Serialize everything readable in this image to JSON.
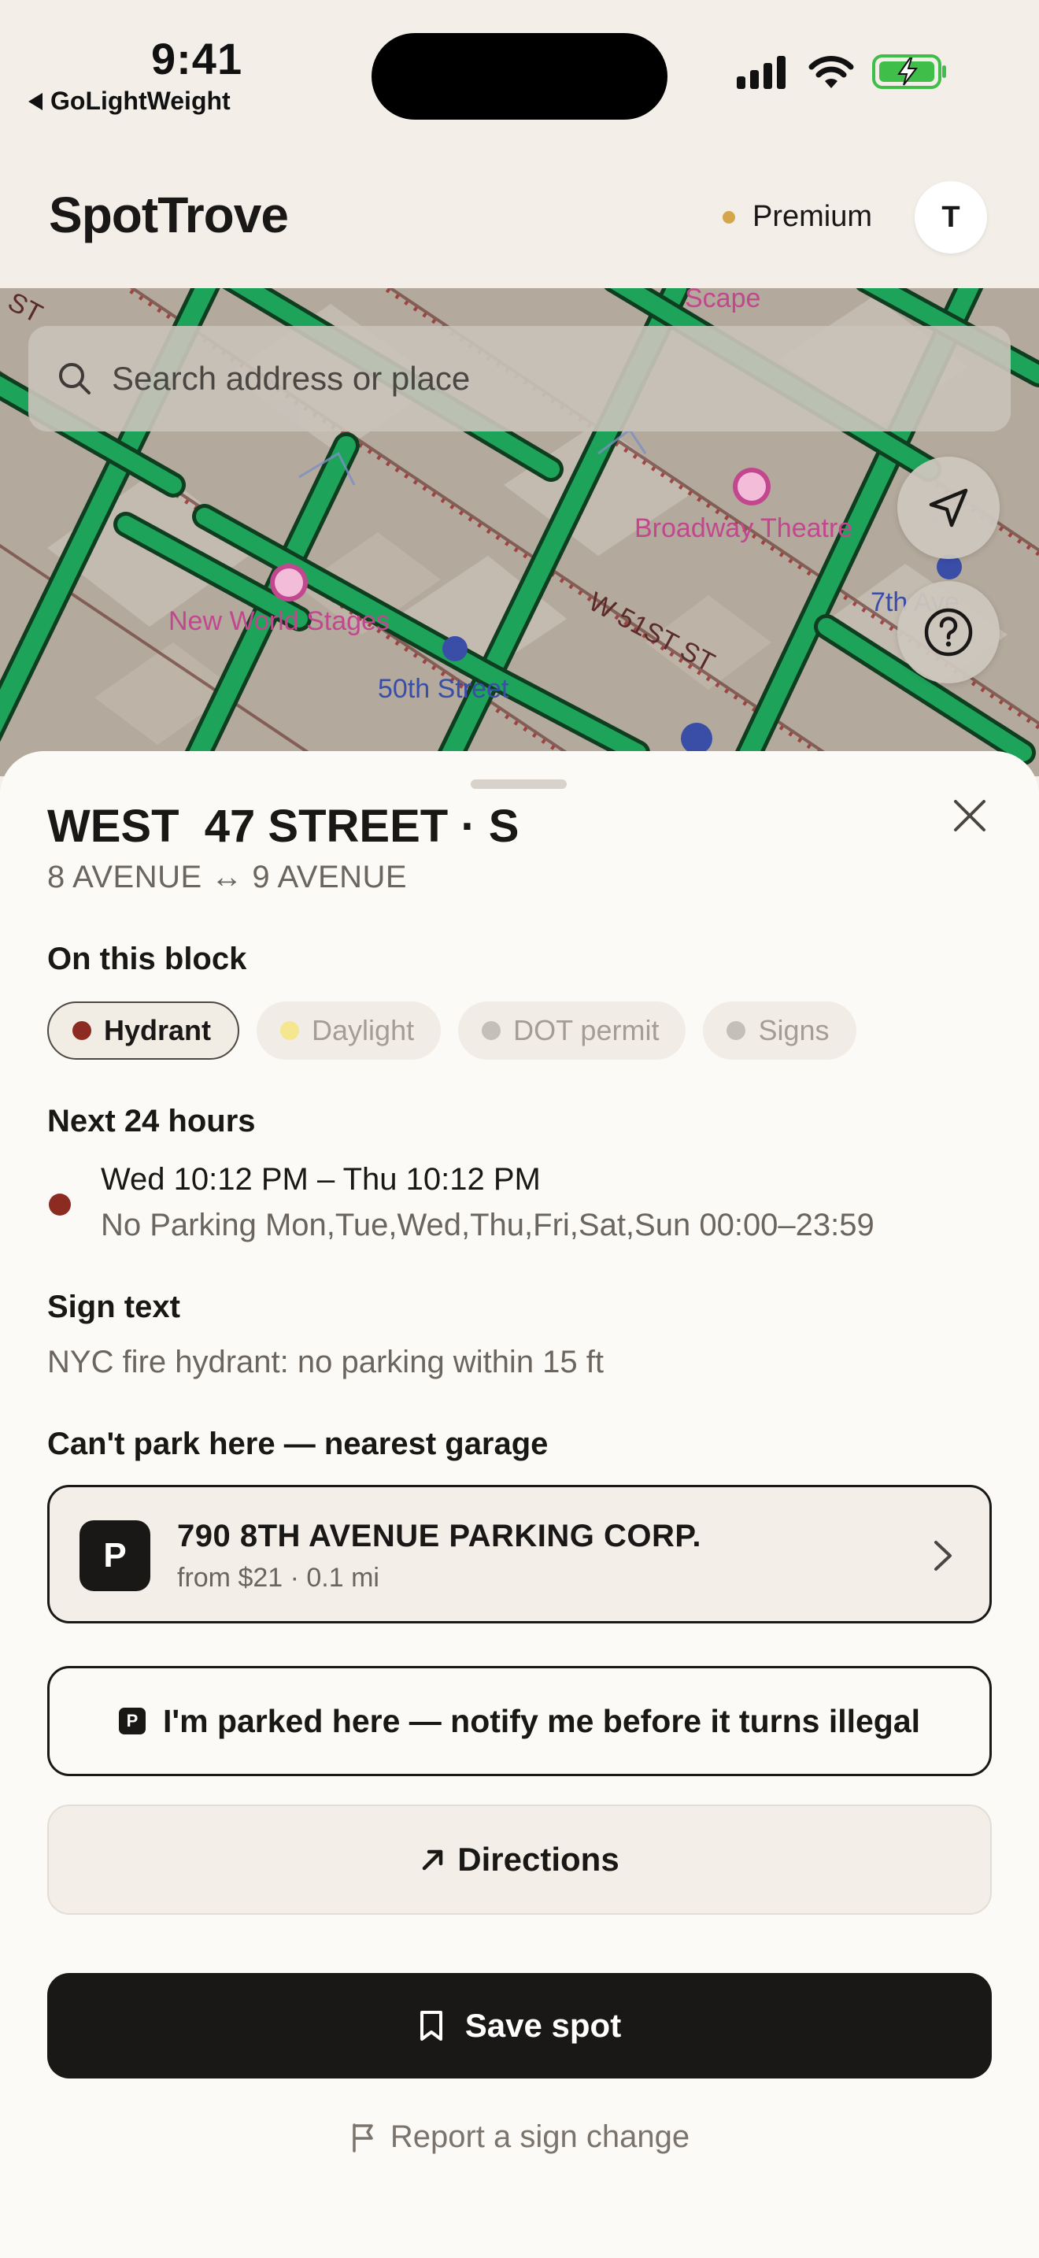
{
  "status_bar": {
    "time": "9:41",
    "back_app": "GoLightWeight",
    "icons": [
      "cellular-signal-icon",
      "wifi-icon",
      "battery-charging-icon"
    ]
  },
  "header": {
    "brand": "SpotTrove",
    "premium_label": "Premium",
    "avatar_initial": "T"
  },
  "map": {
    "search_placeholder": "Search address or place",
    "labels": {
      "broadway_theatre": "Broadway Theatre",
      "new_world_stages": "New World Stages",
      "street_50th": "50th Street",
      "w51st": "W 51ST ST",
      "scape": "Scape",
      "street_top_left": "ST",
      "seventh_ave": "7th Ave"
    },
    "buttons": {
      "locate_icon": "navigation-arrow-icon",
      "help_icon": "question-circle-icon"
    }
  },
  "sheet": {
    "street_title": "WEST  47 STREET · S",
    "cross_streets": "8 AVENUE ↔ 9 AVENUE",
    "on_block_label": "On this block",
    "chips": [
      {
        "label": "Hydrant",
        "color": "#8c2b22",
        "active": true
      },
      {
        "label": "Daylight",
        "color": "#f5e690",
        "active": false
      },
      {
        "label": "DOT permit",
        "color": "#c4bfb8",
        "active": false
      },
      {
        "label": "Signs",
        "color": "#c4bfb8",
        "active": false
      }
    ],
    "next_24_label": "Next 24 hours",
    "schedule": {
      "time_range": "Wed 10:12 PM – Thu 10:12 PM",
      "rule": "No Parking Mon,Tue,Wed,Thu,Fri,Sat,Sun 00:00–23:59",
      "color": "#8c2b22"
    },
    "sign_text_label": "Sign text",
    "sign_text": "NYC fire hydrant: no parking within 15 ft",
    "garage_section_label": "Can't park here — nearest garage",
    "garage": {
      "icon_letter": "P",
      "name": "790 8TH AVENUE PARKING CORP.",
      "meta": "from $21 · 0.1 mi"
    },
    "notify_button": {
      "icon_letter": "P",
      "label": "I'm parked here — notify me before it turns illegal"
    },
    "directions_button": "Directions",
    "save_button": "Save spot",
    "report_link": "Report a sign change"
  },
  "colors": {
    "accent": "#1a1817",
    "premium_dot": "#d4a64a",
    "map_green": "#1ea35a",
    "battery_green": "#3fbf4a"
  }
}
